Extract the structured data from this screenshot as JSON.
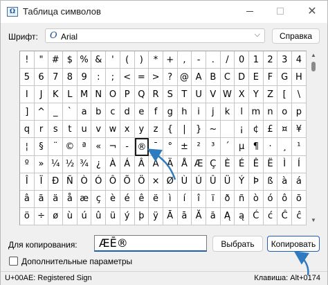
{
  "window": {
    "title": "Таблица символов",
    "icon": "charmap-app-icon",
    "controls": [
      "minimize-icon",
      "maximize-icon",
      "close-icon"
    ]
  },
  "font": {
    "label": "Шрифт:",
    "selected": "Arial",
    "type_glyph": "O",
    "dropdown_icon": "chevron-down-icon"
  },
  "help_button": "Справка",
  "grid": {
    "rows": [
      [
        "!",
        "\"",
        "#",
        "$",
        "%",
        "&",
        "'",
        "(",
        ")",
        "*",
        "+",
        ",",
        "-",
        ".",
        "/",
        "0",
        "1",
        "2",
        "3",
        "4"
      ],
      [
        "5",
        "6",
        "7",
        "8",
        "9",
        ":",
        ";",
        "<",
        "=",
        ">",
        "?",
        "@",
        "A",
        "B",
        "C",
        "D",
        "E",
        "F",
        "G",
        "H"
      ],
      [
        "I",
        "J",
        "K",
        "L",
        "M",
        "N",
        "O",
        "P",
        "Q",
        "R",
        "S",
        "T",
        "U",
        "V",
        "W",
        "X",
        "Y",
        "Z",
        "[",
        "\\"
      ],
      [
        "]",
        "^",
        "_",
        "`",
        "a",
        "b",
        "c",
        "d",
        "e",
        "f",
        "g",
        "h",
        "i",
        "j",
        "k",
        "l",
        "m",
        "n",
        "o",
        "p"
      ],
      [
        "q",
        "r",
        "s",
        "t",
        "u",
        "v",
        "w",
        "x",
        "y",
        "z",
        "{",
        "|",
        "}",
        "~",
        " ",
        "¡",
        "¢",
        "£",
        "¤",
        "¥"
      ],
      [
        "¦",
        "§",
        "¨",
        "©",
        "ª",
        "«",
        "¬",
        "-",
        "®",
        "¯",
        "°",
        "±",
        "²",
        "³",
        "´",
        "µ",
        "¶",
        "·",
        "¸",
        "¹"
      ],
      [
        "º",
        "»",
        "¼",
        "½",
        "¾",
        "¿",
        "À",
        "Á",
        "Â",
        "Ã",
        "Ä",
        "Å",
        "Æ",
        "Ç",
        "È",
        "É",
        "Ê",
        "Ë",
        "Ì",
        "Í"
      ],
      [
        "Î",
        "Ï",
        "Ð",
        "Ñ",
        "Ò",
        "Ó",
        "Ô",
        "Õ",
        "Ö",
        "×",
        "Ø",
        "Ù",
        "Ú",
        "Û",
        "Ü",
        "Ý",
        "Þ",
        "ß",
        "à",
        "á"
      ],
      [
        "â",
        "ã",
        "ä",
        "å",
        "æ",
        "ç",
        "è",
        "é",
        "ê",
        "ë",
        "ì",
        "í",
        "î",
        "ï",
        "ð",
        "ñ",
        "ò",
        "ó",
        "ô",
        "õ"
      ],
      [
        "ö",
        "÷",
        "ø",
        "ù",
        "ú",
        "û",
        "ü",
        "ý",
        "þ",
        "ÿ",
        "Ā",
        "ā",
        "Ă",
        "ă",
        "Ą",
        "ą",
        "Ć",
        "ć",
        "Ĉ",
        "ĉ"
      ]
    ],
    "selected_char": "®"
  },
  "copy": {
    "label": "Для копирования:",
    "value": "ÆĒ®",
    "select_button": "Выбрать",
    "copy_button": "Копировать"
  },
  "advanced": {
    "label": "Дополнительные параметры",
    "checked": false
  },
  "status": {
    "left": "U+00AE: Registered Sign",
    "right": "Клавиша: Alt+0174"
  },
  "colors": {
    "accent": "#1b5fb5",
    "annotation_arrow": "#2f7bbf"
  }
}
